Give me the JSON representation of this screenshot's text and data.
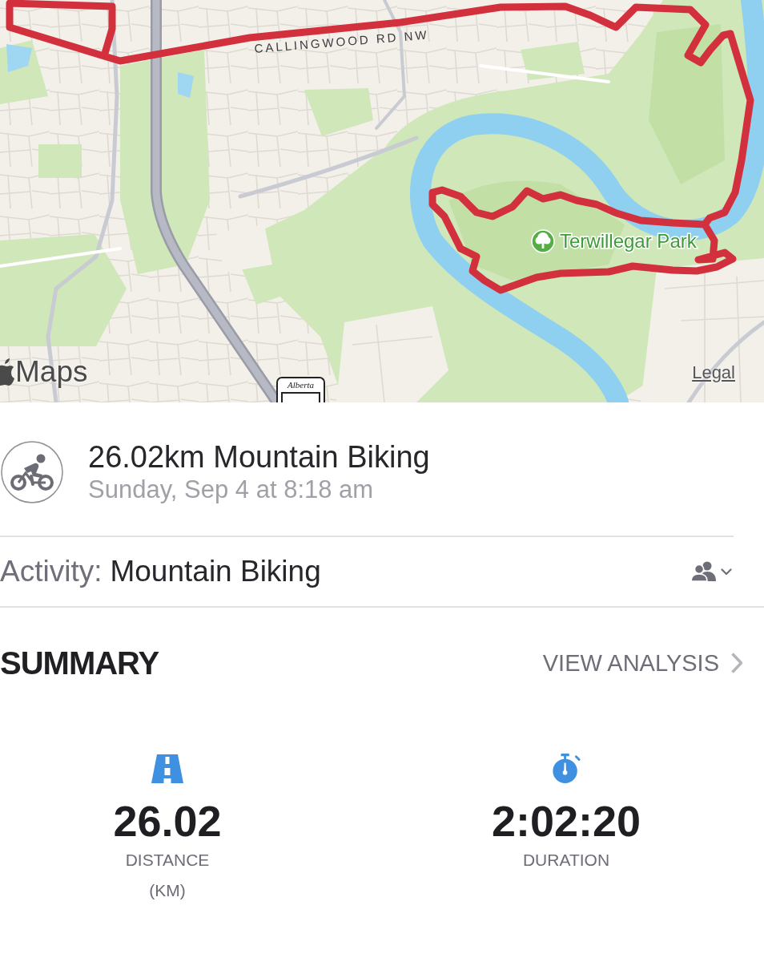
{
  "map": {
    "labels": [
      {
        "kind": "street",
        "text": "CALLINGWOOD RD NW"
      },
      {
        "kind": "park",
        "text": "Terwillegar Park"
      }
    ],
    "shield": {
      "text": "Alberta"
    },
    "brand": "Maps",
    "legal": "Legal"
  },
  "activity_header": {
    "title": "26.02km Mountain Biking",
    "subtitle": "Sunday, Sep 4 at 8:18 am"
  },
  "activity_row": {
    "label": "Activity:",
    "value": "Mountain Biking"
  },
  "summary": {
    "heading": "SUMMARY",
    "link": "VIEW ANALYSIS",
    "stats": [
      {
        "kind": "distance",
        "value": "26.02",
        "label": "DISTANCE",
        "unit": "(KM)"
      },
      {
        "kind": "duration",
        "value": "2:02:20",
        "label": "DURATION"
      }
    ]
  }
}
